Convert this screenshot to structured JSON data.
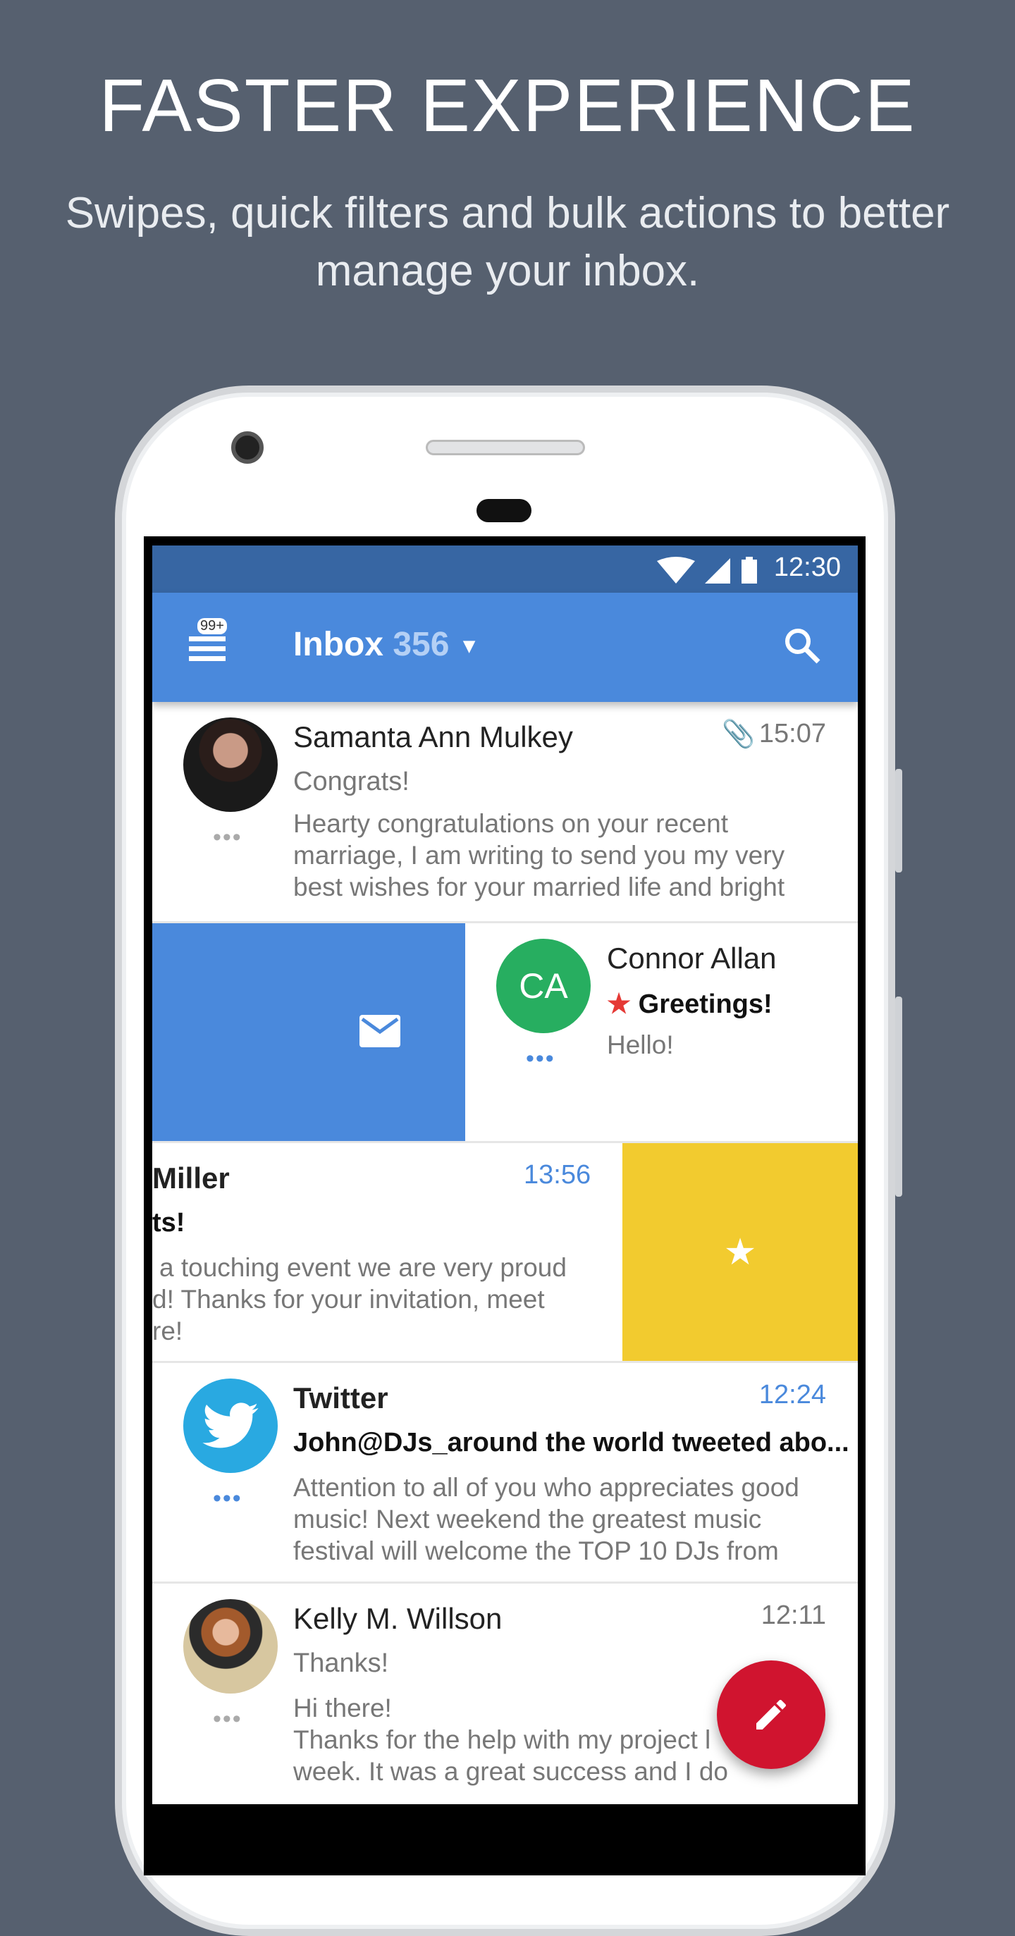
{
  "promo": {
    "title": "FASTER EXPERIENCE",
    "subtitle": "Swipes, quick filters and bulk actions to better manage your inbox."
  },
  "status_bar": {
    "time": "12:30"
  },
  "app_bar": {
    "menu_badge": "99+",
    "folder": "Inbox",
    "count": "356",
    "icons": [
      "menu-icon",
      "dropdown-icon",
      "search-icon"
    ]
  },
  "colors": {
    "accent": "#4a89dc",
    "status": "#3766a3",
    "star_swipe": "#f2cb2f",
    "fab": "#d0142f",
    "twitter": "#29a9e1",
    "avatar_ca": "#27ae60"
  },
  "emails": [
    {
      "sender": "Samanta Ann Mulkey",
      "time": "15:07",
      "subject": "Congrats!",
      "preview": [
        "Hearty congratulations on your recent",
        "marriage, I am writing to send you my very",
        "best wishes for your married life and bright"
      ],
      "attachment": true
    },
    {
      "sender": "Connor Allan",
      "initials": "CA",
      "subject": "Greetings!",
      "starred": true,
      "preview": [
        "Hello!"
      ],
      "swipe_action": "mark-read",
      "unread": true
    },
    {
      "sender": "Miller",
      "time": "13:56",
      "subject": "ts!",
      "preview": [
        "a touching event we are very proud",
        "d! Thanks for your invitation, meet",
        "re!"
      ],
      "swipe_action": "star",
      "unread": true
    },
    {
      "sender": "Twitter",
      "time": "12:24",
      "subject": "John@DJs_around the world tweeted abo...",
      "preview": [
        "Attention to all of you who appreciates good",
        "music! Next weekend the greatest music",
        "festival will welcome the TOP 10 DJs from"
      ],
      "unread": true
    },
    {
      "sender": "Kelly M. Willson",
      "time": "12:11",
      "subject": "Thanks!",
      "preview": [
        "Hi there!",
        "Thanks for the help with my project l",
        "week. It was a great success and I do"
      ]
    }
  ]
}
